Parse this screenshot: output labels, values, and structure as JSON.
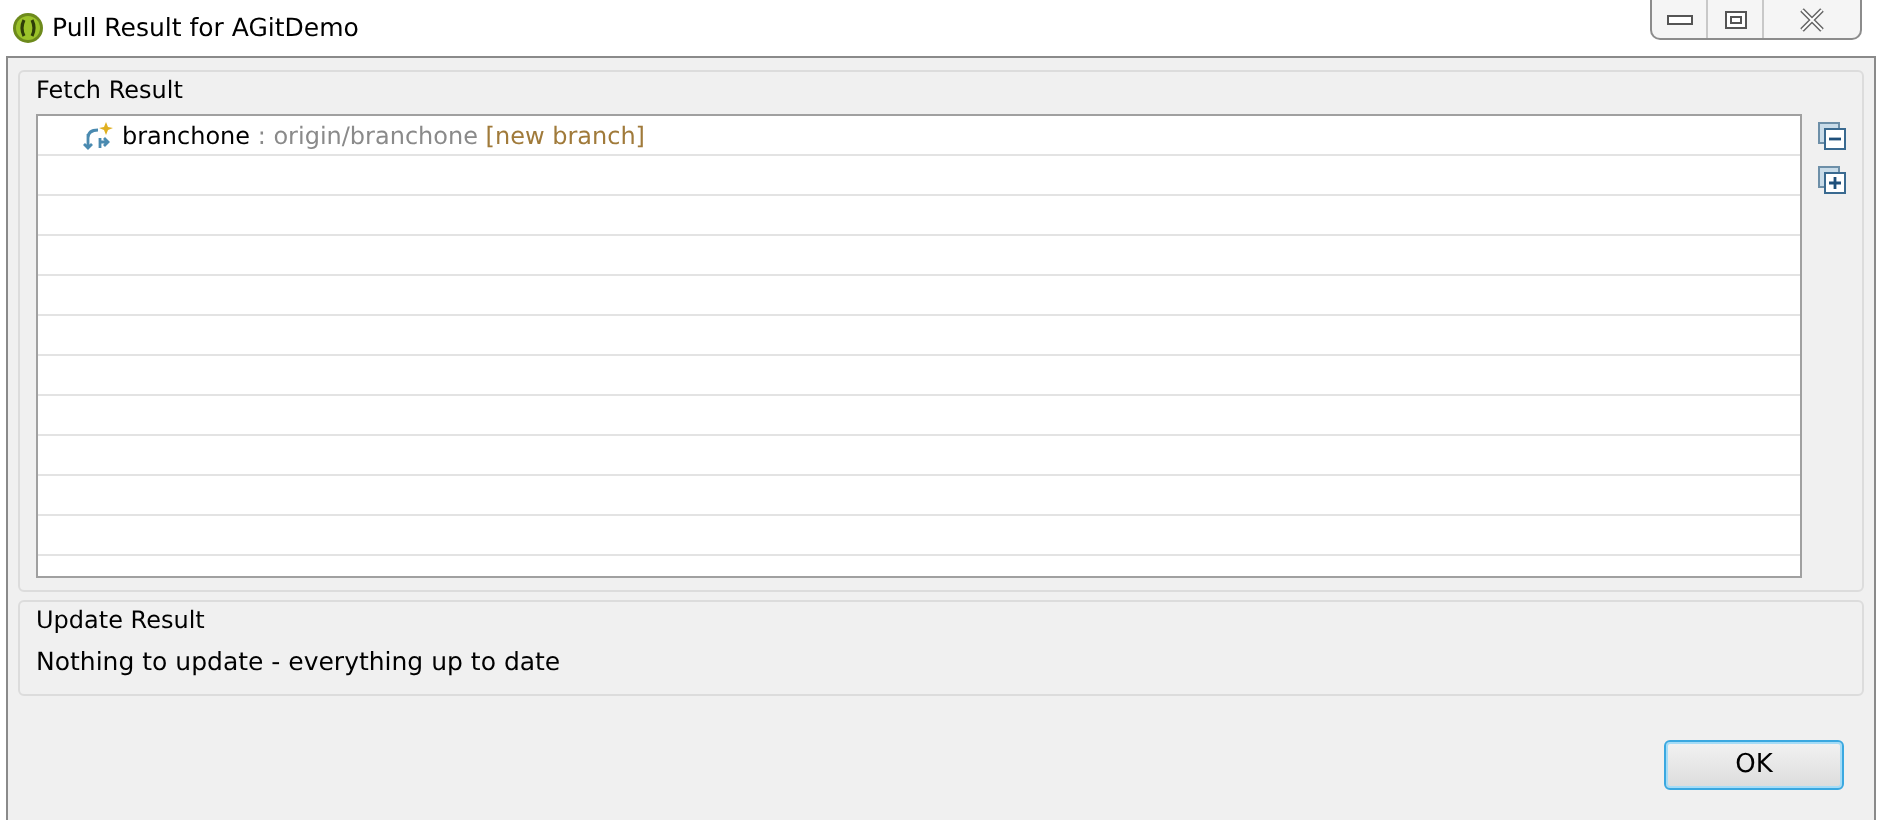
{
  "window": {
    "title": "Pull Result for AGitDemo"
  },
  "fetch_result": {
    "title": "Fetch Result",
    "items": [
      {
        "name": "branchone",
        "separator": ":",
        "ref": "origin/branchone",
        "status": "[new branch]"
      }
    ]
  },
  "update_result": {
    "title": "Update Result",
    "message": "Nothing to update - everything up to date"
  },
  "buttons": [
    "OK"
  ]
}
